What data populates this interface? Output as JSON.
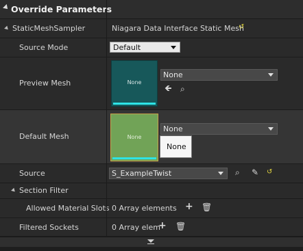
{
  "header": {
    "title": "Override Parameters"
  },
  "sampler": {
    "label": "StaticMeshSampler",
    "value": "Niagara Data Interface Static Mesh"
  },
  "source_mode": {
    "label": "Source Mode",
    "value": "Default"
  },
  "preview_mesh": {
    "label": "Preview Mesh",
    "thumb_text": "None",
    "value": "None"
  },
  "default_mesh": {
    "label": "Default Mesh",
    "thumb_text": "None",
    "value": "None",
    "popup_text": "None"
  },
  "source": {
    "label": "Source",
    "value": "S_ExampleTwist"
  },
  "section_filter": {
    "label": "Section Filter"
  },
  "allowed_slots": {
    "label": "Allowed Material Slots",
    "value": "0 Array elements"
  },
  "filtered_sockets": {
    "label": "Filtered Sockets",
    "value": "0 Array elem"
  },
  "colors": {
    "preview_thumb": "#17585a",
    "default_thumb": "#71a357",
    "accent_line": "#2ee3e6",
    "reset_yellow": "#e3d640"
  }
}
